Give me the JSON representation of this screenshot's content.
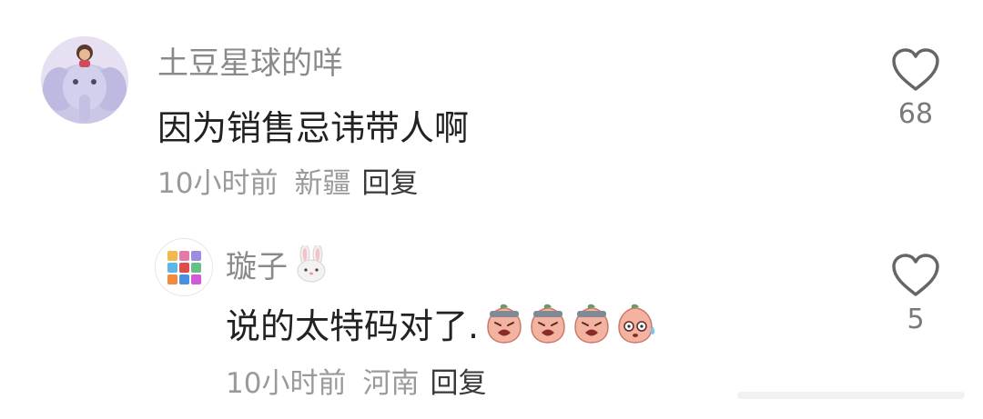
{
  "comments": [
    {
      "username": "土豆星球的咩",
      "text": "因为销售忌讳带人啊",
      "time": "10小时前",
      "region": "新疆",
      "reply_label": "回复",
      "like_count": "68"
    },
    {
      "username": "璇子",
      "text": "说的太特码对了.",
      "time": "10小时前",
      "region": "河南",
      "reply_label": "回复",
      "like_count": "5"
    }
  ],
  "icons": {
    "like": "heart-outline-icon",
    "username_badge": "rabbit-face-emoji",
    "reply_emojis": [
      "crying-peach-emoji",
      "crying-peach-emoji",
      "crying-peach-emoji",
      "sweating-peach-emoji"
    ]
  },
  "colors": {
    "username": "#8a8a8a",
    "comment_text": "#222222",
    "meta": "#9a9a9a",
    "reply": "#3a3a3a",
    "like_icon": "#666666"
  }
}
